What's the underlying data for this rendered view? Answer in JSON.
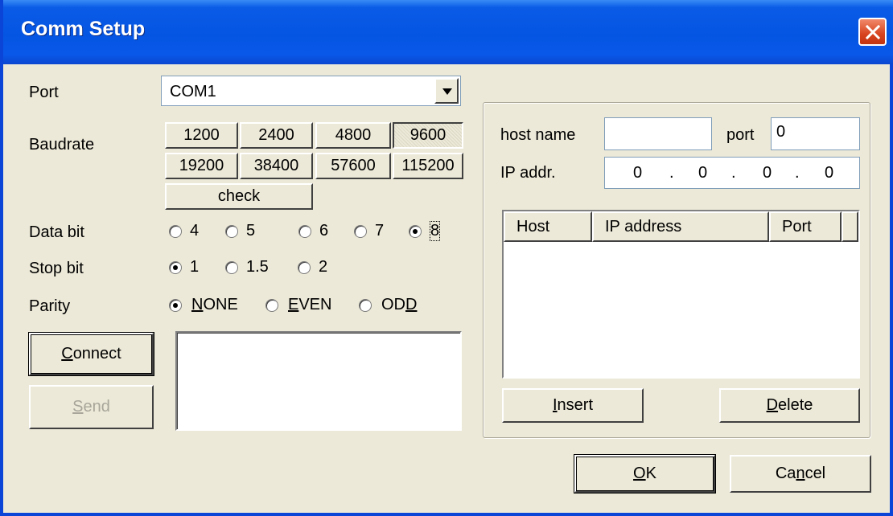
{
  "window": {
    "title": "Comm Setup"
  },
  "labels": {
    "port": "Port",
    "baudrate": "Baudrate",
    "data_bit": "Data bit",
    "stop_bit": "Stop bit",
    "parity": "Parity"
  },
  "port_select": {
    "value": "COM1"
  },
  "baudrate": {
    "buttons": [
      "1200",
      "2400",
      "4800",
      "9600",
      "19200",
      "38400",
      "57600",
      "115200"
    ],
    "selected": "9600",
    "check_label": "check"
  },
  "data_bit": {
    "options": [
      "4",
      "5",
      "6",
      "7",
      "8"
    ],
    "selected": "8"
  },
  "stop_bit": {
    "options": [
      "1",
      "1.5",
      "2"
    ],
    "selected": "1"
  },
  "parity": {
    "options": [
      "NONE",
      "EVEN",
      "ODD"
    ],
    "selected": "NONE"
  },
  "buttons": {
    "connect": "Connect",
    "send": "Send",
    "insert": "Insert",
    "delete": "Delete",
    "ok": "OK",
    "cancel": "Cancel"
  },
  "network": {
    "host_name_label": "host name",
    "host_name_value": "",
    "port_label": "port",
    "port_value": "0",
    "ip_label": "IP addr.",
    "ip_octets": [
      "0",
      "0",
      "0",
      "0"
    ],
    "columns": [
      "Host",
      "IP address",
      "Port"
    ]
  }
}
